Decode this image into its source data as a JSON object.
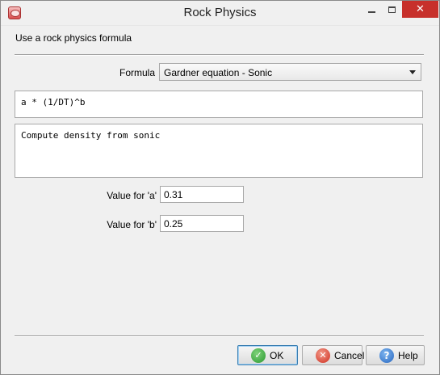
{
  "window": {
    "title": "Rock Physics",
    "close_glyph": "✕"
  },
  "dialog": {
    "instruction": "Use a rock physics formula",
    "formula_label": "Formula",
    "formula_selected": "Gardner equation - Sonic",
    "expression": "a * (1/DT)^b",
    "description": "Compute density from sonic",
    "params": [
      {
        "label": "Value for 'a'",
        "value": "0.31"
      },
      {
        "label": "Value for 'b'",
        "value": "0.25"
      }
    ]
  },
  "buttons": {
    "ok": "OK",
    "cancel": "Cancel",
    "help": "Help",
    "ok_glyph": "✓",
    "cancel_glyph": "✕",
    "help_glyph": "?"
  },
  "icons": {
    "app": "app-icon",
    "minimize": "minimize-icon",
    "maximize": "maximize-icon",
    "close": "close-icon",
    "ok": "checkmark-icon",
    "cancel": "cancel-icon",
    "help": "help-icon",
    "dropdown": "chevron-down-icon"
  },
  "colors": {
    "close_button": "#c7302b",
    "ok_icon": "#2b9a32",
    "cancel_icon": "#cf2e1f",
    "help_icon": "#2766c0"
  }
}
